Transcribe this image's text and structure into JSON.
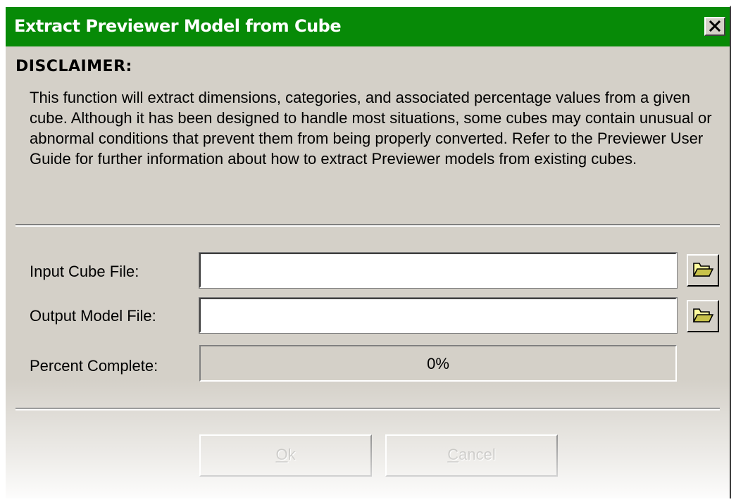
{
  "window": {
    "title": "Extract Previewer Model from Cube",
    "close_glyph": "✕"
  },
  "disclaimer": {
    "heading": "DISCLAIMER:",
    "text": "This function will extract dimensions, categories, and associated percentage values from a given cube. Although it has been designed to handle most situations, some cubes may contain unusual or abnormal conditions that prevent them from being properly converted. Refer to the Previewer User Guide for further information about how to extract Previewer models from existing cubes."
  },
  "form": {
    "input_cube_label": "Input Cube File:",
    "input_cube_value": "",
    "output_model_label": "Output Model File:",
    "output_model_value": "",
    "browse_icon": "folder-open-icon",
    "percent_label": "Percent Complete:",
    "percent_value": "0%",
    "progress_fraction": 0
  },
  "buttons": {
    "ok": {
      "mnemonic": "O",
      "rest": "k",
      "enabled": false
    },
    "cancel": {
      "mnemonic": "C",
      "rest": "ancel",
      "enabled": false
    }
  },
  "colors": {
    "titlebar": "#078a07",
    "dialog_bg": "#d4d0c8",
    "disabled_text": "#8c8a84"
  }
}
